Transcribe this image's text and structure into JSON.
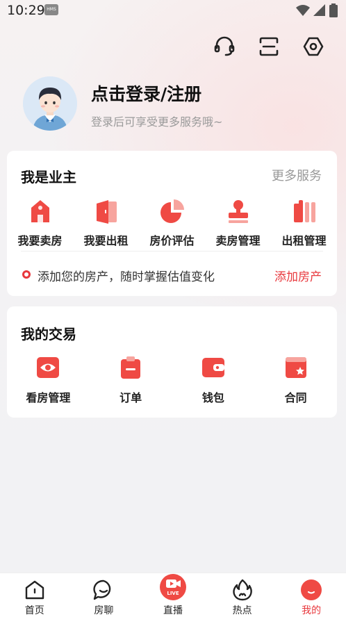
{
  "status_bar": {
    "time": "10:29",
    "badge": "HMS"
  },
  "profile": {
    "title": "点击登录/注册",
    "subtitle": "登录后可享受更多服务哦~"
  },
  "owner_section": {
    "title": "我是业主",
    "more": "更多服务",
    "items": [
      {
        "label": "我要卖房",
        "icon": "house-icon"
      },
      {
        "label": "我要出租",
        "icon": "door-icon"
      },
      {
        "label": "房价评估",
        "icon": "pie-chart-icon"
      },
      {
        "label": "卖房管理",
        "icon": "stamp-icon"
      },
      {
        "label": "出租管理",
        "icon": "bars-icon"
      }
    ],
    "tip": "添加您的房产，随时掌握估值变化",
    "tip_action": "添加房产"
  },
  "trade_section": {
    "title": "我的交易",
    "items": [
      {
        "label": "看房管理",
        "icon": "eye-icon"
      },
      {
        "label": "订单",
        "icon": "clipboard-icon"
      },
      {
        "label": "钱包",
        "icon": "wallet-icon"
      },
      {
        "label": "合同",
        "icon": "contract-icon"
      }
    ]
  },
  "bottom_nav": {
    "items": [
      {
        "label": "首页",
        "icon": "home-icon"
      },
      {
        "label": "房聊",
        "icon": "chat-icon"
      },
      {
        "label": "直播",
        "icon": "live-icon",
        "badge": "LIVE"
      },
      {
        "label": "热点",
        "icon": "flame-icon"
      },
      {
        "label": "我的",
        "icon": "profile-icon"
      }
    ],
    "active": "我的"
  },
  "colors": {
    "accent": "#e8383d",
    "icon_red": "#ef4a44"
  }
}
